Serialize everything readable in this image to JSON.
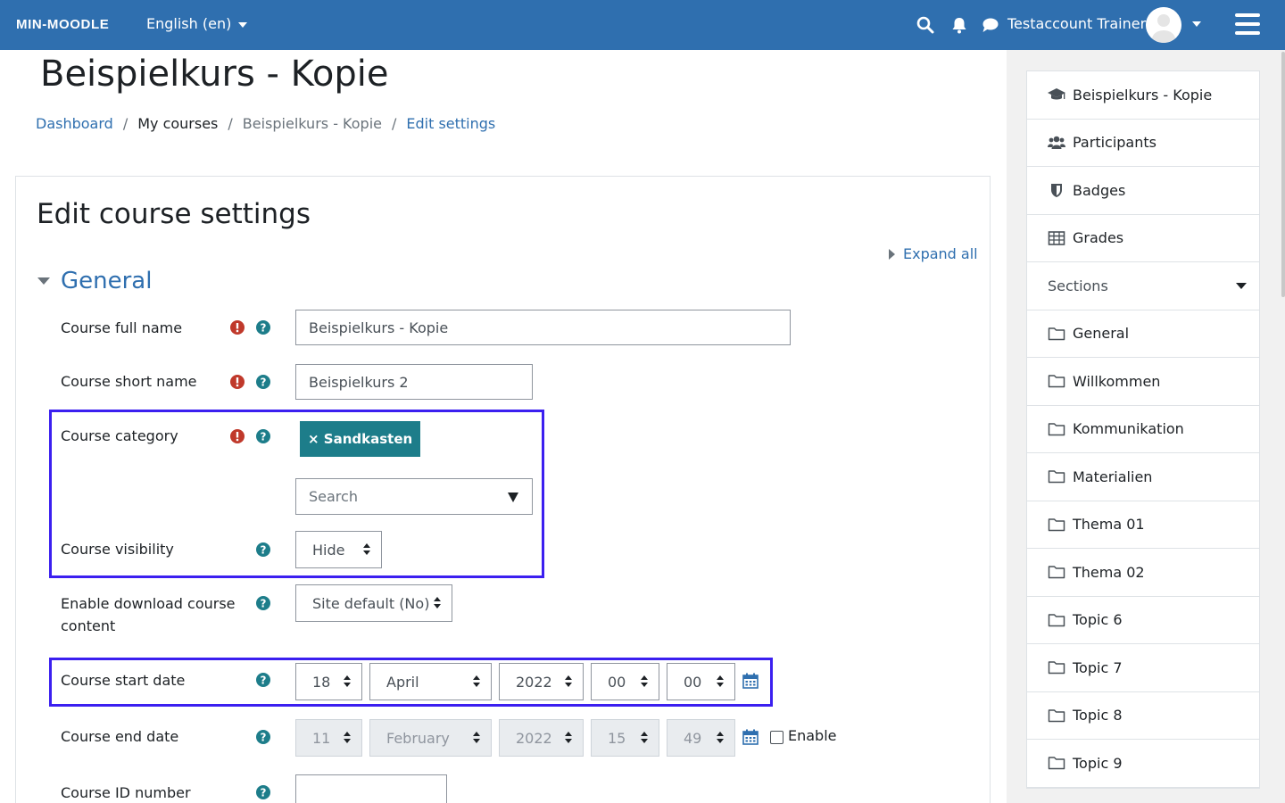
{
  "navbar": {
    "brand": "MIN-MOODLE",
    "language": "English (en)",
    "user_name": "Testaccount Trainer",
    "icons": [
      "search-icon",
      "bell-icon",
      "chat-icon",
      "avatar",
      "menu-icon"
    ],
    "color": "#2f6faf"
  },
  "page": {
    "title": "Beispielkurs - Kopie",
    "breadcrumb": [
      "Dashboard",
      "My courses",
      "Beispielkurs - Kopie",
      "Edit settings"
    ]
  },
  "form": {
    "heading": "Edit course settings",
    "expand_all": "Expand all",
    "section": "General",
    "fullname": {
      "label": "Course full name",
      "value": "Beispielkurs - Kopie"
    },
    "shortname": {
      "label": "Course short name",
      "value": "Beispielkurs 2"
    },
    "category": {
      "label": "Course category",
      "selected": "× Sandkasten",
      "search_placeholder": "Search"
    },
    "visibility": {
      "label": "Course visibility",
      "value": "Hide"
    },
    "download": {
      "label_line1": "Enable download course",
      "label_line2": "content",
      "value": "Site default (No)"
    },
    "startdate": {
      "label": "Course start date",
      "day": "18",
      "month": "April",
      "year": "2022",
      "hour": "00",
      "minute": "00"
    },
    "enddate": {
      "label": "Course end date",
      "day": "11",
      "month": "February",
      "year": "2022",
      "hour": "15",
      "minute": "49",
      "enable_label": "Enable",
      "enabled": false
    },
    "idnumber": {
      "label": "Course ID number",
      "value": ""
    }
  },
  "sidebar": {
    "items": [
      {
        "label": "Beispielkurs - Kopie",
        "icon": "graduation-cap-icon"
      },
      {
        "label": "Participants",
        "icon": "users-icon"
      },
      {
        "label": "Badges",
        "icon": "shield-icon"
      },
      {
        "label": "Grades",
        "icon": "table-icon"
      },
      {
        "label": "Sections",
        "icon": ""
      },
      {
        "label": "General",
        "icon": "folder-icon"
      },
      {
        "label": "Willkommen",
        "icon": "folder-icon"
      },
      {
        "label": "Kommunikation",
        "icon": "folder-icon"
      },
      {
        "label": "Materialien",
        "icon": "folder-icon"
      },
      {
        "label": "Thema 01",
        "icon": "folder-icon"
      },
      {
        "label": "Thema 02",
        "icon": "folder-icon"
      },
      {
        "label": "Topic 6",
        "icon": "folder-icon"
      },
      {
        "label": "Topic 7",
        "icon": "folder-icon"
      },
      {
        "label": "Topic 8",
        "icon": "folder-icon"
      },
      {
        "label": "Topic 9",
        "icon": "folder-icon"
      }
    ]
  },
  "colors": {
    "required": "#c0392b",
    "help": "#1d7d8a",
    "highlight": "#3b1ff0",
    "link": "#2f6faf"
  }
}
